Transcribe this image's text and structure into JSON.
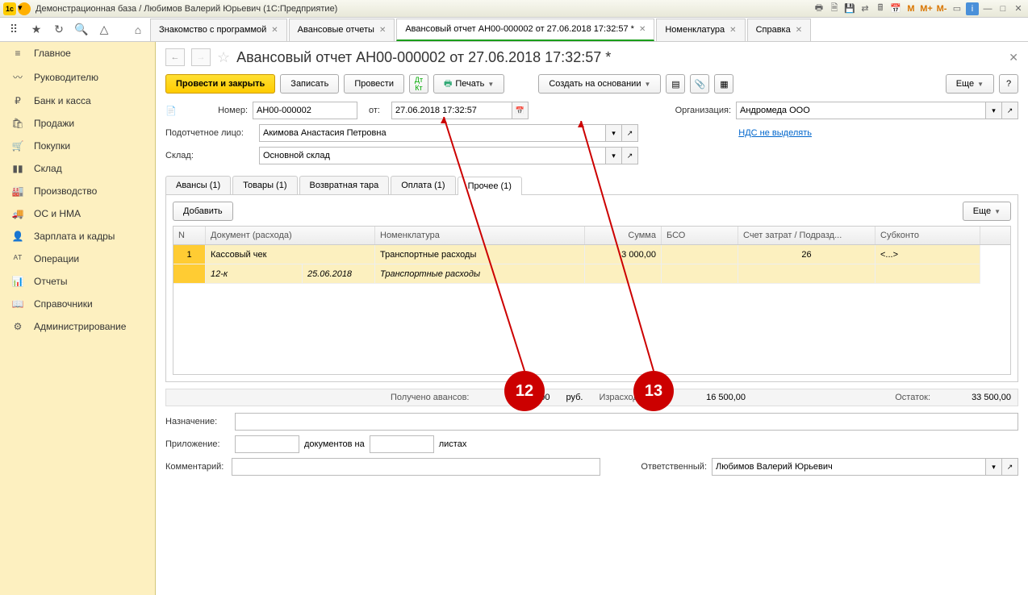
{
  "window": {
    "title": "Демонстрационная база / Любимов Валерий Юрьевич  (1С:Предприятие)"
  },
  "tabs": [
    {
      "label": "Знакомство с программой"
    },
    {
      "label": "Авансовые отчеты"
    },
    {
      "label": "Авансовый отчет АН00-000002 от 27.06.2018 17:32:57 *",
      "active": true
    },
    {
      "label": "Номенклатура"
    },
    {
      "label": "Справка"
    }
  ],
  "sidebar": [
    {
      "icon": "≡",
      "label": "Главное"
    },
    {
      "icon": "〰",
      "label": "Руководителю"
    },
    {
      "icon": "₽",
      "label": "Банк и касса"
    },
    {
      "icon": "🛍",
      "label": "Продажи"
    },
    {
      "icon": "🛒",
      "label": "Покупки"
    },
    {
      "icon": "▮▮",
      "label": "Склад"
    },
    {
      "icon": "🏭",
      "label": "Производство"
    },
    {
      "icon": "🚚",
      "label": "ОС и НМА"
    },
    {
      "icon": "👤",
      "label": "Зарплата и кадры"
    },
    {
      "icon": "ᴬᵀ",
      "label": "Операции"
    },
    {
      "icon": "📊",
      "label": "Отчеты"
    },
    {
      "icon": "📖",
      "label": "Справочники"
    },
    {
      "icon": "⚙",
      "label": "Администрирование"
    }
  ],
  "doc": {
    "title": "Авансовый отчет АН00-000002 от 27.06.2018 17:32:57 *",
    "actions": {
      "post_close": "Провести и закрыть",
      "write": "Записать",
      "post": "Провести",
      "print": "Печать",
      "create_based": "Создать на основании",
      "more": "Еще"
    },
    "fields": {
      "number_label": "Номер:",
      "number": "АН00-000002",
      "date_label": "от:",
      "date": "27.06.2018 17:32:57",
      "org_label": "Организация:",
      "org": "Андромеда ООО",
      "person_label": "Подотчетное лицо:",
      "person": "Акимова Анастасия Петровна",
      "vat_link": "НДС не выделять",
      "warehouse_label": "Склад:",
      "warehouse": "Основной склад"
    },
    "doc_tabs": [
      {
        "label": "Авансы (1)"
      },
      {
        "label": "Товары (1)"
      },
      {
        "label": "Возвратная тара"
      },
      {
        "label": "Оплата (1)"
      },
      {
        "label": "Прочее (1)",
        "active": true
      }
    ],
    "add_btn": "Добавить",
    "more_btn": "Еще",
    "grid_headers": {
      "n": "N",
      "doc": "Документ (расхода)",
      "nom": "Номенклатура",
      "sum": "Сумма",
      "bso": "БСО",
      "acct": "Счет затрат / Подразд...",
      "sub": "Субконто"
    },
    "grid_rows": [
      {
        "n": "1",
        "doc": "Кассовый чек",
        "nom": "Транспортные расходы",
        "sum": "3 000,00",
        "bso": "",
        "acct": "26",
        "sub": "<...>"
      },
      {
        "n": "",
        "doc": "12-к",
        "doc2": "25.06.2018",
        "nom": "Транспортные расходы",
        "italic": true
      }
    ],
    "totals": {
      "adv_label": "Получено авансов:",
      "adv_val": "50 000,00",
      "currency": "руб.",
      "spent_label": "Израсходовано:",
      "spent_val": "16 500,00",
      "rest_label": "Остаток:",
      "rest_val": "33 500,00"
    },
    "footer": {
      "purpose_label": "Назначение:",
      "attach_label": "Приложение:",
      "docs_on": "документов на",
      "sheets": "листах",
      "comment_label": "Комментарий:",
      "resp_label": "Ответственный:",
      "resp": "Любимов Валерий Юрьевич"
    }
  },
  "annotations": {
    "a12": "12",
    "a13": "13"
  }
}
